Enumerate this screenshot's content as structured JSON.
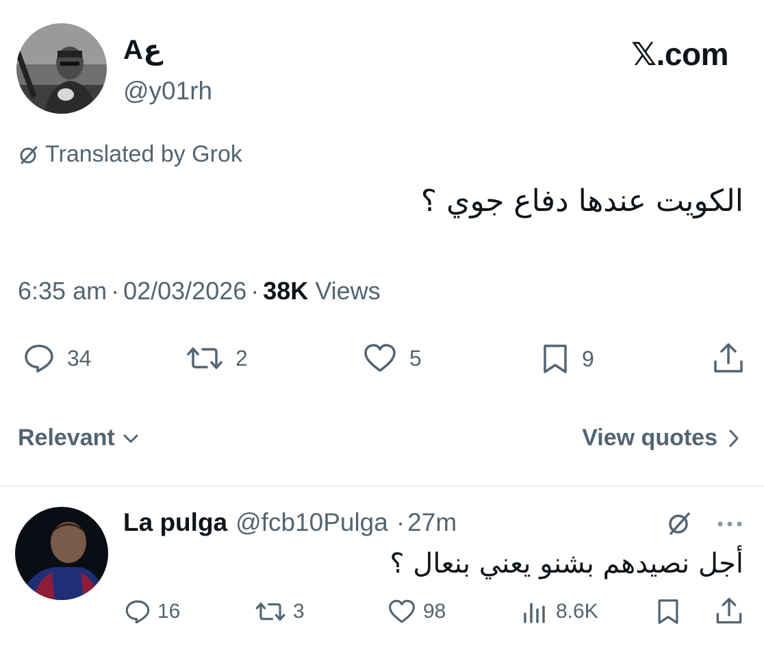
{
  "header": {
    "display_name": "Aع",
    "handle": "@y01rh",
    "site_brand": "𝕏.com"
  },
  "translation": {
    "label": "Translated by Grok"
  },
  "tweet": {
    "text": "الكويت عندها دفاع جوي ؟",
    "time": "6:35 am",
    "separator": "·",
    "date": "02/03/2026",
    "views_count": "38K",
    "views_label": "Views",
    "replies": "34",
    "reposts": "2",
    "likes": "5",
    "bookmarks": "9"
  },
  "sort": {
    "relevant_label": "Relevant",
    "view_quotes_label": "View quotes"
  },
  "reply": {
    "name": "La pulga",
    "handle": "@fcb10Pulga",
    "separator": "·",
    "time": "27m",
    "text": "أجل نصيدهم بشنو يعني بنعال ؟",
    "replies": "16",
    "reposts": "3",
    "likes": "98",
    "views": "8.6K"
  },
  "icons": {
    "reply": "speech-bubble-icon",
    "repost": "repost-arrows-icon",
    "like": "heart-icon",
    "bookmark": "bookmark-icon",
    "share": "share-icon",
    "views": "bar-chart-icon",
    "grok": "grok-slash-icon",
    "more": "more-dots-icon",
    "chevron_down": "chevron-down-icon",
    "chevron_right": "chevron-right-icon"
  },
  "colors": {
    "text_primary": "#0f1419",
    "text_secondary": "#536471",
    "divider": "#eff3f4"
  }
}
